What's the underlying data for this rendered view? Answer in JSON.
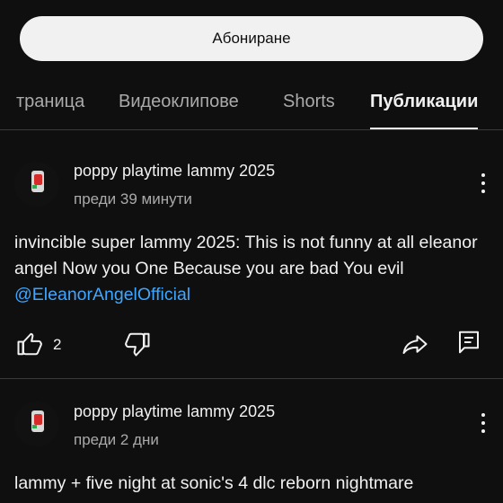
{
  "subscribe_label": "Абониране",
  "tabs": [
    {
      "label": "траница"
    },
    {
      "label": "Видеоклипове"
    },
    {
      "label": "Shorts"
    },
    {
      "label": "Публикации",
      "active": true
    }
  ],
  "posts": [
    {
      "author": "poppy playtime lammy 2025",
      "time": "преди 39 минути",
      "text_before": "invincible super lammy 2025: This is not funny at all eleanor angel Now you One Because you are bad You evil ",
      "mention": "@EleanorAngelOfficial",
      "likes": "2"
    },
    {
      "author": "poppy playtime lammy 2025",
      "time": "преди 2 дни",
      "text_before": "lammy + five night at sonic's 4 dlc reborn nightmare"
    }
  ],
  "icons": {
    "like": "thumbs-up-icon",
    "dislike": "thumbs-down-icon",
    "share": "share-icon",
    "comment": "comment-icon",
    "menu": "more-vertical-icon"
  },
  "colors": {
    "background": "#0f0f0f",
    "accent_link": "#3ea6ff",
    "button_bg": "#f1f1f1"
  }
}
